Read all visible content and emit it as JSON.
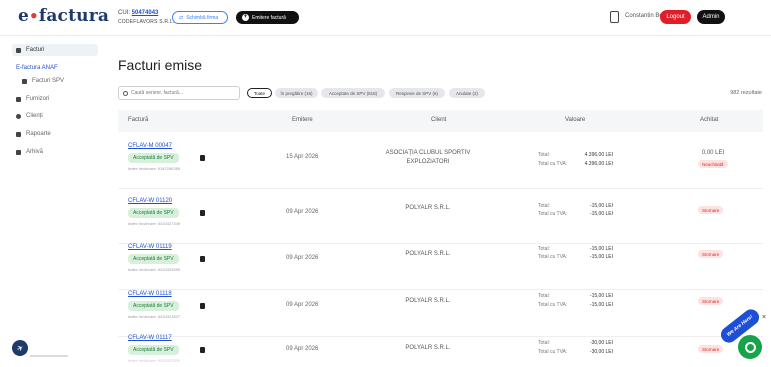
{
  "header": {
    "logo_brand": "e",
    "logo_dot": "•",
    "logo_name": "factura",
    "cui_label": "CUI:",
    "cui_value": "50474043",
    "company_name": "CODEFLAVORS S.R.L.",
    "change_company_label": "Schimbă firma",
    "emit_invoice_label": "Emitere factură",
    "user_name": "Constantin Boiangiu",
    "logout_label": "Logout",
    "admin_label": "Admin"
  },
  "sidebar": {
    "facturi_label": "Facturi",
    "efactura_section": "E-factura ANAF",
    "items": [
      {
        "label": "Facturi SPV"
      },
      {
        "label": "Furnizori"
      },
      {
        "label": "Clienți"
      },
      {
        "label": "Rapoarte"
      },
      {
        "label": "Arhivă"
      }
    ]
  },
  "main": {
    "title": "Facturi emise",
    "search_placeholder": "Caută serienr, factură...",
    "filters": [
      "Toate",
      "În pregătire (16)",
      "Acceptate de SPV (818)",
      "Respinse de SPV (6)",
      "Anulate (2)"
    ],
    "results": "982 rezultate",
    "columns": {
      "invoice": "Factură",
      "issued": "Emitere",
      "client": "Client",
      "value": "Valoare",
      "paid": "Achitat"
    },
    "rows": [
      {
        "number": "CFLAV-M 00047",
        "status": "Acceptată de SPV",
        "index": "Index încărcare: 6347196389",
        "date": "15 Apr 2026",
        "client": "ASOCIAȚIA CLUBUL SPORTIV EXPLOZIATORI",
        "total_label": "Total:",
        "total_value": "4.396,00 LEI",
        "total_vat_label": "Total cu TVA:",
        "total_vat_value": "4.396,00 LEI",
        "paid_amount": "0,00 LEI",
        "paid_status": "Neachitată"
      },
      {
        "number": "CFLAV-W 01120",
        "status": "Acceptată de SPV",
        "index": "Index încărcare: 6334327449",
        "date": "09 Apr 2026",
        "client": "POLYALR S.R.L.",
        "total_label": "Total:",
        "total_value": "-15,00 LEI",
        "total_vat_label": "Total cu TVA:",
        "total_vat_value": "-15,00 LEI",
        "paid_status": "Stornare"
      },
      {
        "number": "CFLAV-W 01119",
        "status": "Acceptată de SPV",
        "index": "Index încărcare: 6334325559",
        "date": "09 Apr 2026",
        "client": "POLYALR S.R.L.",
        "total_label": "Total:",
        "total_value": "-15,00 LEI",
        "total_vat_label": "Total cu TVA:",
        "total_vat_value": "-15,00 LEI",
        "paid_status": "Stornare"
      },
      {
        "number": "CFLAV-W 01118",
        "status": "Acceptată de SPV",
        "index": "Index încărcare: 6334323827",
        "date": "09 Apr 2026",
        "client": "POLYALR S.R.L.",
        "total_label": "Total:",
        "total_value": "-15,00 LEI",
        "total_vat_label": "Total cu TVA:",
        "total_vat_value": "-15,00 LEI",
        "paid_status": "Stornare"
      },
      {
        "number": "CFLAV-W 01117",
        "status": "Acceptată de SPV",
        "index": "Index încărcare: 6334321000",
        "date": "09 Apr 2026",
        "client": "POLYALR S.R.L.",
        "total_label": "Total:",
        "total_value": "-30,00 LEI",
        "total_vat_label": "Total cu TVA:",
        "total_vat_value": "-30,00 LEI",
        "paid_status": "Stornare"
      }
    ]
  },
  "chat": {
    "tag": "We Are Here!",
    "close": "×"
  },
  "colors": {
    "brand": "#1e3a6b",
    "link": "#1d4ed8",
    "danger": "#e11d2a",
    "accepted_bg": "#d7f0dc",
    "accepted_text": "#1f7a3a",
    "chat": "#16a34a"
  }
}
